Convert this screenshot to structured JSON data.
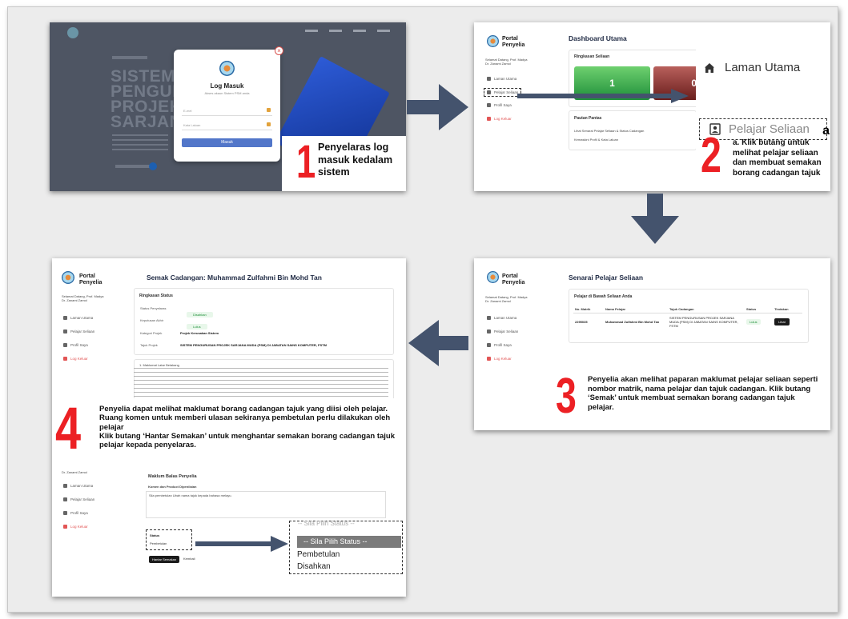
{
  "colors": {
    "accent_red": "#ec2024",
    "arrow": "#44536d",
    "green": "#1f8f3a"
  },
  "portal": {
    "title_line1": "Portal",
    "title_line2": "Penyelia",
    "welcome_line1": "Selamat Datang, Prof. Madya",
    "welcome_line2": "Dr. Zanami Zamol",
    "nav": [
      "Laman Utama",
      "Pelajar Seliaan",
      "Profil Saya",
      "Log Keluar"
    ]
  },
  "panel1": {
    "bg_headline": [
      "SISTEM",
      "PENGURU",
      "PROJEK",
      "SARJANA"
    ],
    "login": {
      "title": "Log Masuk",
      "subtitle": "Akses akaun Sistem PSM anda",
      "email_placeholder": "E-mel",
      "password_placeholder": "Kata Laluan",
      "button": "Masuk"
    },
    "step_number": "1",
    "step_text": "Penyelaras log masuk kedalam sistem"
  },
  "panel2": {
    "title": "Dashboard Utama",
    "summary_title": "Ringkasan Seliaan",
    "stat_green": "1",
    "stat_red": "0",
    "shortcuts_title": "Pautan Pantas",
    "shortcut_1": "Lihat Senarai Pelajar Seliaan & Status Cadangan",
    "shortcut_2": "Kemaskini Profil & Kata Laluan",
    "zoom_home": "Laman Utama",
    "zoom_pelajar": "Pelajar Seliaan",
    "zoom_badge": "a",
    "step_number": "2",
    "step_text": "a. Klik butang untuk melihat pelajar seliaan dan membuat semakan borang cadangan tajuk"
  },
  "panel3": {
    "title": "Senarai Pelajar Seliaan",
    "card_title": "Pelajar di Bawah Seliaan Anda",
    "columns": [
      "No. Matrik",
      "Nama Pelajar",
      "Tajuk Cadangan",
      "Status",
      "Tindakan"
    ],
    "row": {
      "matrik": "2295035",
      "nama": "Muhammad Zulfahmi Bin Mohd Tan",
      "tajuk": "SISTEM PENGURUSAN PROJEK SARJANA MUDA (PSM) DI JABATAN SAINS KOMPUTER, FSTM",
      "status": "Lulus",
      "tindakan": "Lihat"
    },
    "step_number": "3",
    "step_text": "Penyelia akan melihat paparan maklumat pelajar seliaan seperti nombor matrik, nama pelajar dan tajuk cadangan. Klik butang ‘Semak’ untuk membuat semakan borang cadangan tajuk pelajar."
  },
  "panel4": {
    "title": "Semak Cadangan: Muhammad Zulfahmi Bin Mohd Tan",
    "status_card_title": "Ringkasan Status",
    "status_rows": [
      {
        "label": "Status Penyelaras",
        "value": "Disahkan"
      },
      {
        "label": "Keputusan Akhir",
        "value": "Lulus"
      }
    ],
    "kategori_label": "Kategori Projek",
    "kategori_value": "Projek Kerusakan Sistem",
    "tajuk_label": "Tajuk Projek",
    "tajuk_value": "SISTEM PENGURUSAN PROJEK SARJANA MUDA (PSM) DI JABATAN SAINS KOMPUTER, FSTM",
    "section_heading": "1. Maklumat Latar Belakang",
    "step_number": "4",
    "step_text_1": "Penyelia dapat melihat maklumat borang cadangan tajuk yang diisi oleh pelajar.",
    "step_text_2": "Ruang komen untuk memberi ulasan sekiranya pembetulan perlu dilakukan oleh pelajar",
    "step_text_3": "Klik butang ‘Hantar Semakan’ untuk menghantar semakan borang cadangan tajuk pelajar kepada penyelaras.",
    "ulasan_title": "Maklum Balas Penyelia",
    "komen_label": "Komen dan Product Dipenilaian",
    "komen_value": "Sila pembetulan Ubah nama tajuk kepada bahasa melayu.",
    "status_label": "Status",
    "status_value": "Pembetulan",
    "btn_hantar": "Hantar Semakan",
    "btn_kembali": "Kembali",
    "dropdown_ghost": "-- Sila Pilih Status --",
    "dropdown_options": [
      "-- Sila Pilih Status --",
      "Pembetulan",
      "Disahkan"
    ]
  }
}
